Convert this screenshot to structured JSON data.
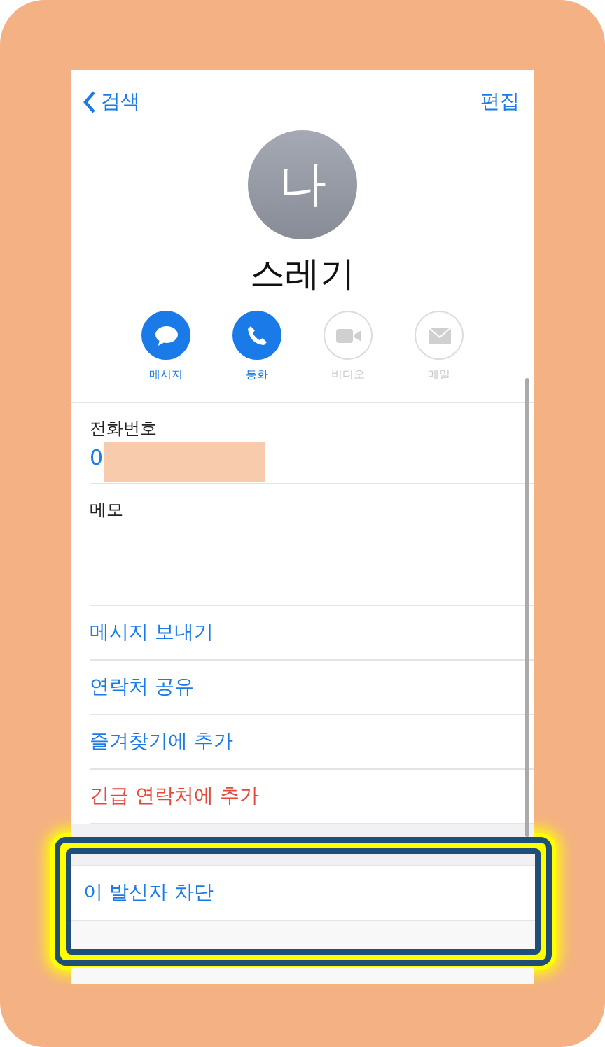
{
  "nav": {
    "back": "검색",
    "edit": "편집"
  },
  "contact": {
    "initial": "나",
    "name": "스레기"
  },
  "actions": [
    {
      "kind": "message",
      "label": "메시지",
      "disabled": false
    },
    {
      "kind": "call",
      "label": "통화",
      "disabled": false
    },
    {
      "kind": "video",
      "label": "비디오",
      "disabled": true
    },
    {
      "kind": "mail",
      "label": "메일",
      "disabled": true
    }
  ],
  "phone": {
    "label": "전화번호",
    "value": "0"
  },
  "memo": {
    "label": "메모"
  },
  "links": [
    {
      "label": "메시지 보내기",
      "kind": "normal"
    },
    {
      "label": "연락처 공유",
      "kind": "normal"
    },
    {
      "label": "즐겨찾기에 추가",
      "kind": "normal"
    },
    {
      "label": "긴급 연락처에 추가",
      "kind": "danger"
    }
  ],
  "block": {
    "label": "이 발신자 차단"
  }
}
